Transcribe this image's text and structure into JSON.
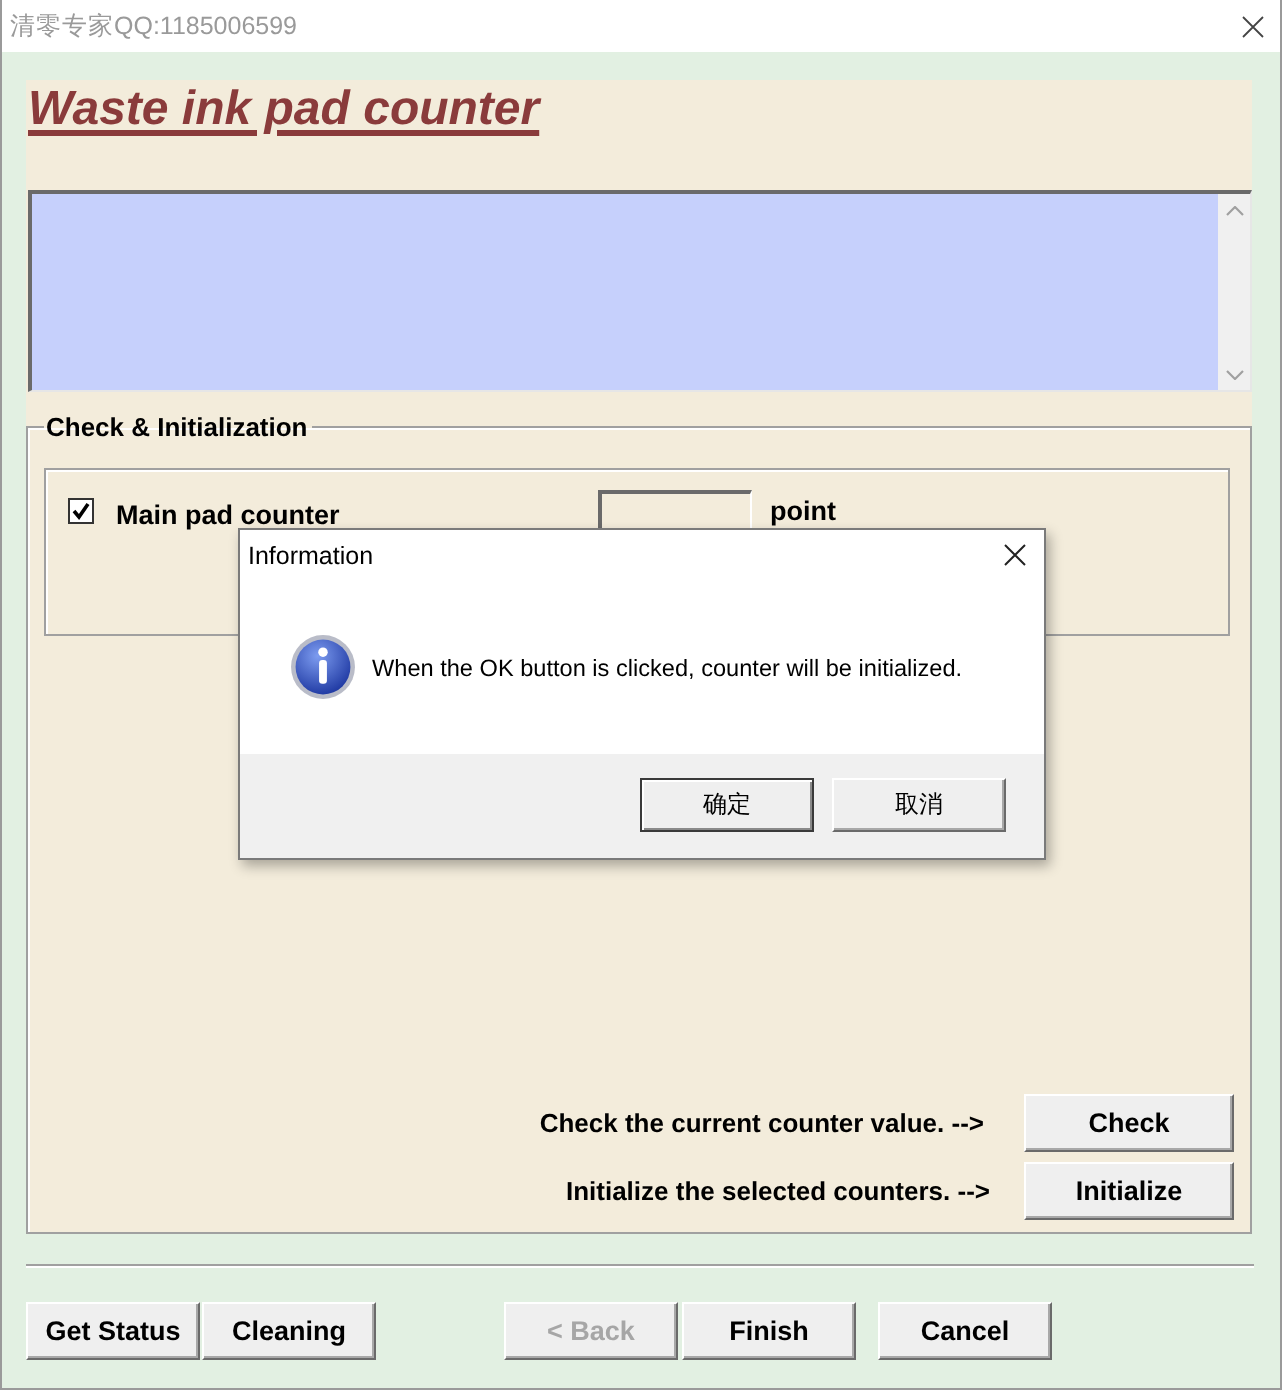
{
  "window": {
    "title": "清零专家QQ:1185006599"
  },
  "header": {
    "title": "Waste ink pad counter"
  },
  "group": {
    "title": "Check & Initialization",
    "counters": [
      {
        "label": "Main pad counter",
        "checked": true,
        "unit": "point"
      }
    ]
  },
  "actions": [
    {
      "hint": "Check the current counter value. -->",
      "button": "Check"
    },
    {
      "hint": "Initialize the selected counters. -->",
      "button": "Initialize"
    }
  ],
  "footer": {
    "left_buttons": [
      {
        "label": "Get Status",
        "disabled": false
      },
      {
        "label": "Cleaning",
        "disabled": false
      }
    ],
    "nav_buttons": [
      {
        "label": "< Back",
        "disabled": true
      },
      {
        "label": "Finish",
        "disabled": false
      }
    ],
    "right_buttons": [
      {
        "label": "Cancel",
        "disabled": false
      }
    ]
  },
  "dialog": {
    "title": "Information",
    "message": "When the OK button is clicked, counter will be initialized.",
    "buttons": [
      {
        "label": "确定",
        "default": true
      },
      {
        "label": "取消",
        "default": false
      }
    ]
  }
}
